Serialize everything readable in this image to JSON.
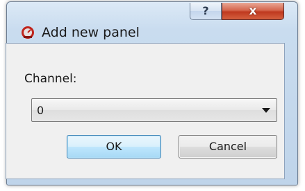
{
  "dialog": {
    "title": "Add new panel",
    "help_glyph": "?",
    "close_glyph": "x",
    "icon": "app-gauge-icon"
  },
  "form": {
    "channel_label": "Channel:",
    "channel_value": "0"
  },
  "buttons": {
    "ok_label": "OK",
    "cancel_label": "Cancel"
  },
  "colors": {
    "ok_border": "#3c7fb1",
    "close_red": "#c0391f",
    "icon_red": "#c0241c"
  }
}
